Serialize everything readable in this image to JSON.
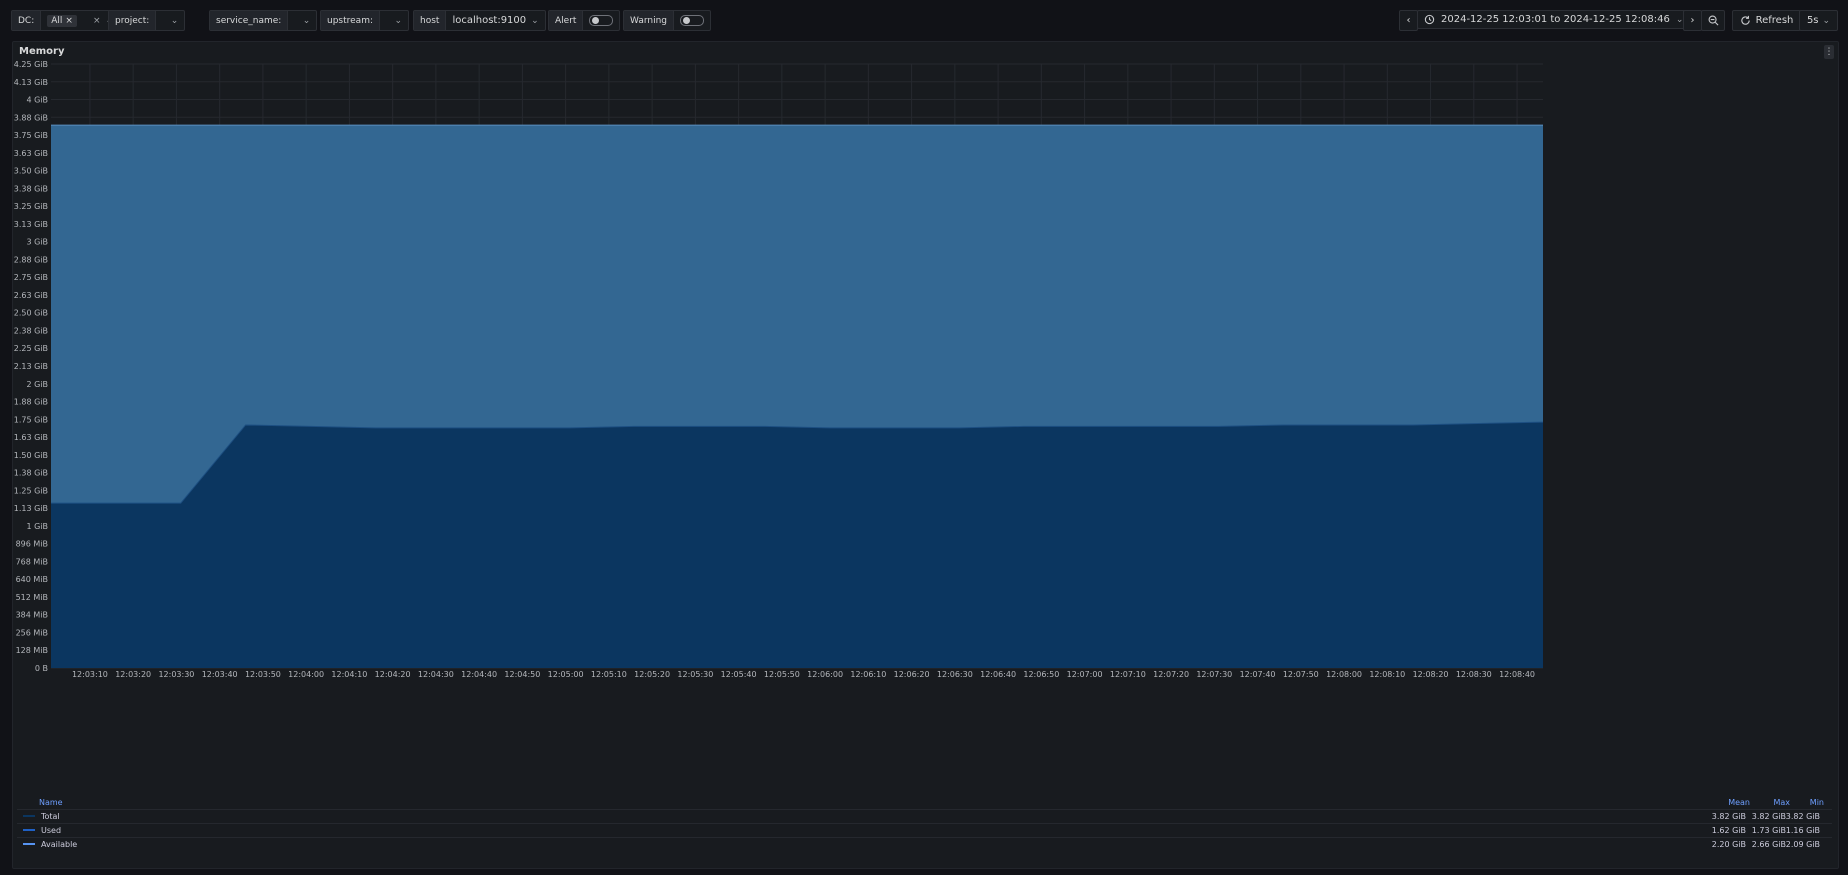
{
  "topbar": {
    "dc": {
      "label": "DC:",
      "chip": "All",
      "chip_close": "×",
      "clear": "×"
    },
    "project": {
      "label": "project:"
    },
    "service_name": {
      "label": "service_name:"
    },
    "upstream": {
      "label": "upstream:"
    },
    "host": {
      "label": "host",
      "value": "localhost:9100"
    },
    "alert": {
      "label": "Alert"
    },
    "warning": {
      "label": "Warning"
    },
    "time_range": "2024-12-25 12:03:01 to 2024-12-25 12:08:46",
    "refresh_label": "Refresh",
    "refresh_interval": "5s"
  },
  "panel": {
    "title": "Memory"
  },
  "chart_data": {
    "type": "area",
    "title": "Memory",
    "y_ticks": [
      "4.25 GiB",
      "4.13 GiB",
      "4 GiB",
      "3.88 GiB",
      "3.75 GiB",
      "3.63 GiB",
      "3.50 GiB",
      "3.38 GiB",
      "3.25 GiB",
      "3.13 GiB",
      "3 GiB",
      "2.88 GiB",
      "2.75 GiB",
      "2.63 GiB",
      "2.50 GiB",
      "2.38 GiB",
      "2.25 GiB",
      "2.13 GiB",
      "2 GiB",
      "1.88 GiB",
      "1.75 GiB",
      "1.63 GiB",
      "1.50 GiB",
      "1.38 GiB",
      "1.25 GiB",
      "1.13 GiB",
      "1 GiB",
      "896 MiB",
      "768 MiB",
      "640 MiB",
      "512 MiB",
      "384 MiB",
      "256 MiB",
      "128 MiB",
      "0 B"
    ],
    "ylim_gib": [
      0,
      4.25
    ],
    "x_ticks": [
      "12:03:10",
      "12:03:20",
      "12:03:30",
      "12:03:40",
      "12:03:50",
      "12:04:00",
      "12:04:10",
      "12:04:20",
      "12:04:30",
      "12:04:40",
      "12:04:50",
      "12:05:00",
      "12:05:10",
      "12:05:20",
      "12:05:30",
      "12:05:40",
      "12:05:50",
      "12:06:00",
      "12:06:10",
      "12:06:20",
      "12:06:30",
      "12:06:40",
      "12:06:50",
      "12:07:00",
      "12:07:10",
      "12:07:20",
      "12:07:30",
      "12:07:40",
      "12:07:50",
      "12:08:00",
      "12:08:10",
      "12:08:20",
      "12:08:30",
      "12:08:40"
    ],
    "x": [
      "12:03:01",
      "12:03:16",
      "12:03:31",
      "12:03:46",
      "12:04:01",
      "12:04:16",
      "12:04:31",
      "12:04:46",
      "12:05:01",
      "12:05:16",
      "12:05:31",
      "12:05:46",
      "12:06:01",
      "12:06:16",
      "12:06:31",
      "12:06:46",
      "12:07:01",
      "12:07:16",
      "12:07:31",
      "12:07:46",
      "12:08:01",
      "12:08:16",
      "12:08:31",
      "12:08:46"
    ],
    "series": [
      {
        "name": "Total",
        "color": "#0b3660",
        "values": [
          3.82,
          3.82,
          3.82,
          3.82,
          3.82,
          3.82,
          3.82,
          3.82,
          3.82,
          3.82,
          3.82,
          3.82,
          3.82,
          3.82,
          3.82,
          3.82,
          3.82,
          3.82,
          3.82,
          3.82,
          3.82,
          3.82,
          3.82,
          3.82
        ]
      },
      {
        "name": "Used",
        "color": "#0b3660",
        "values": [
          1.16,
          1.16,
          1.16,
          1.71,
          1.7,
          1.69,
          1.69,
          1.69,
          1.69,
          1.7,
          1.7,
          1.7,
          1.69,
          1.69,
          1.69,
          1.7,
          1.7,
          1.7,
          1.7,
          1.71,
          1.71,
          1.71,
          1.72,
          1.73
        ]
      },
      {
        "name": "Available",
        "color": "#336792",
        "values": [
          2.66,
          2.66,
          2.66,
          2.11,
          2.12,
          2.13,
          2.13,
          2.13,
          2.13,
          2.12,
          2.12,
          2.12,
          2.13,
          2.13,
          2.13,
          2.12,
          2.12,
          2.12,
          2.12,
          2.11,
          2.11,
          2.11,
          2.1,
          2.09
        ]
      }
    ],
    "legend_placement": "bottom",
    "grid": true
  },
  "legend": {
    "headers": {
      "name": "Name",
      "mean": "Mean",
      "max": "Max",
      "min": "Min"
    },
    "rows": [
      {
        "name": "Total",
        "color": "#0b3660",
        "mean": "3.82 GiB",
        "max": "3.82 GiB",
        "min": "3.82 GiB"
      },
      {
        "name": "Used",
        "color": "#1f60c4",
        "mean": "1.62 GiB",
        "max": "1.73 GiB",
        "min": "1.16 GiB"
      },
      {
        "name": "Available",
        "color": "#5794f2",
        "mean": "2.20 GiB",
        "max": "2.66 GiB",
        "min": "2.09 GiB"
      }
    ]
  }
}
